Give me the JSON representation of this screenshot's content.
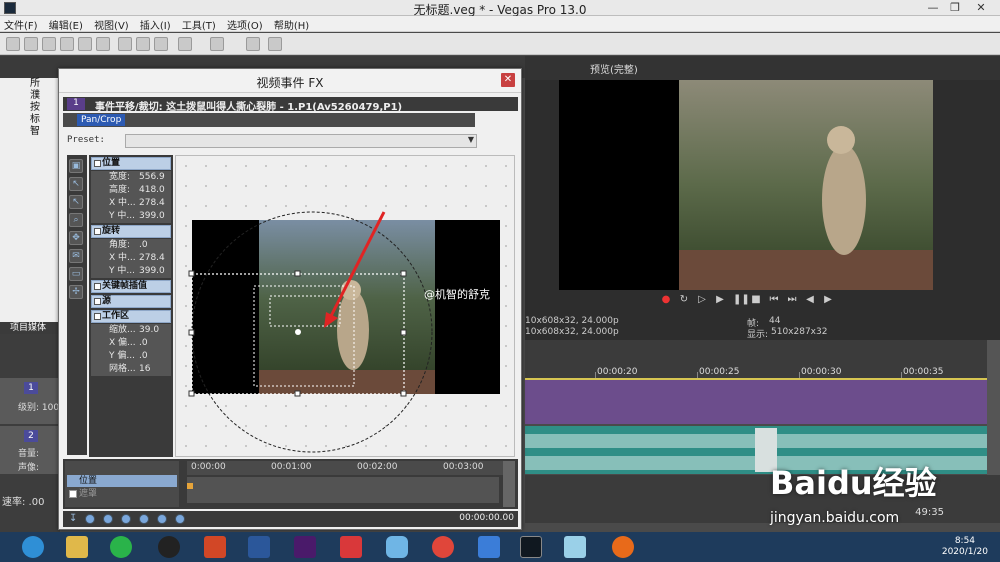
{
  "window": {
    "title": "无标题.veg * - Vegas Pro 13.0"
  },
  "menu": [
    "文件(F)",
    "编辑(E)",
    "视图(V)",
    "插入(I)",
    "工具(T)",
    "选项(O)",
    "帮助(H)"
  ],
  "explorer": {
    "items": [
      "所",
      "濮",
      "按",
      "标",
      "智"
    ],
    "tab": "项目媒体"
  },
  "tracks": {
    "video_num": "1",
    "video_level": "级别: 100",
    "audio_num": "2",
    "audio_volume": "音量:",
    "audio_pan": "声像:"
  },
  "speed": "速率: .00",
  "preview": {
    "mode": "预览(完整)",
    "info_left1": "10x608x32, 24.000p",
    "info_left2": "10x608x32, 24.000p",
    "frame_label": "帧:",
    "frame_value": "44",
    "display_label": "显示:",
    "display_value": "510x287x32"
  },
  "timeline": {
    "marks": [
      "00:00:20",
      "00:00:25",
      "00:00:30",
      "00:00:35"
    ],
    "end_time": "49:35"
  },
  "fx": {
    "title": "视频事件 FX",
    "chain_num": "1",
    "chain_label": "事件平移/裁切: 这土拨鼠叫得人撕心裂肺 - 1.P1(Av5260479,P1)",
    "plugin_tab": "Pan/Crop",
    "preset_label": "Preset:",
    "sections": {
      "position": "位置",
      "rotation": "旋转",
      "keyframe_interp": "关键帧插值",
      "source": "源",
      "workspace": "工作区"
    },
    "props": {
      "width_label": "宽度:",
      "width_value": "556.9",
      "height_label": "高度:",
      "height_value": "418.0",
      "xc_label": "X 中...",
      "xc_value": "278.4",
      "yc_label": "Y 中...",
      "yc_value": "399.0",
      "angle_label": "角度:",
      "angle_value": ".0",
      "rxc_label": "X 中...",
      "rxc_value": "278.4",
      "ryc_label": "Y 中...",
      "ryc_value": "399.0",
      "zoom_label": "缩放...",
      "zoom_value": "39.0",
      "xoff_label": "X 偏...",
      "xoff_value": ".0",
      "yoff_label": "Y 偏...",
      "yoff_value": ".0",
      "grid_label": "网格...",
      "grid_value": "16"
    },
    "watermark": "@机智的舒克",
    "keyframes": {
      "row1": "位置",
      "row2": "遮罩",
      "ruler": [
        "0:00:00",
        "00:01:00",
        "00:02:00",
        "00:03:00"
      ],
      "time": "00:00:00.00"
    }
  },
  "taskbar": {
    "time": "8:54",
    "date": "2020/1/20"
  },
  "baidu": {
    "logo": "Baidu经验",
    "url": "jingyan.baidu.com"
  }
}
